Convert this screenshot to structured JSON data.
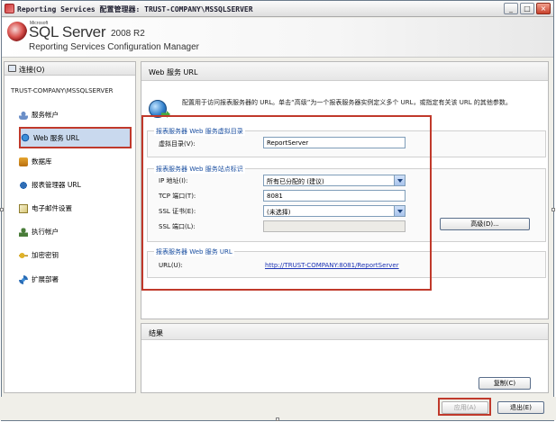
{
  "window": {
    "title": "Reporting Services 配置管理器: TRUST-COMPANY\\MSSQLSERVER",
    "controls": [
      "_",
      "□",
      "×"
    ]
  },
  "banner": {
    "microsoft": "Microsoft",
    "product": "SQL Server",
    "version": "2008 R2",
    "subtitle": "Reporting Services Configuration Manager"
  },
  "sidebar": {
    "connect_label": "连接(O)",
    "server_name": "TRUST-COMPANY\\MSSQLSERVER",
    "items": [
      {
        "label": "服务帐户",
        "icon": "service-account-icon"
      },
      {
        "label": "Web 服务 URL",
        "icon": "web-globe-icon",
        "active": true
      },
      {
        "label": "数据库",
        "icon": "database-icon"
      },
      {
        "label": "报表管理器 URL",
        "icon": "report-manager-icon"
      },
      {
        "label": "电子邮件设置",
        "icon": "email-icon"
      },
      {
        "label": "执行帐户",
        "icon": "execution-account-icon"
      },
      {
        "label": "加密密钥",
        "icon": "key-icon"
      },
      {
        "label": "扩展部署",
        "icon": "scale-out-icon"
      }
    ]
  },
  "main": {
    "section_title": "Web 服务 URL",
    "description": "配置用于访问报表服务器的 URL。单击“高级”为一个报表服务器实例定义多个 URL，或指定有关该 URL 的其他参数。",
    "virtual_dir_group": {
      "title": "报表服务器 Web 服务虚拟目录",
      "label": "虚拟目录(V):",
      "value": "ReportServer"
    },
    "site_group": {
      "title": "报表服务器 Web 服务站点标识",
      "ip_label": "IP 地址(I):",
      "ip_value": "所有已分配的 (建议)",
      "tcp_label": "TCP 端口(T):",
      "tcp_value": "8081",
      "ssl_cert_label": "SSL 证书(E):",
      "ssl_cert_value": "(未选择)",
      "ssl_port_label": "SSL 端口(L):",
      "ssl_port_value": "",
      "advanced_button": "高级(D)..."
    },
    "url_group": {
      "title": "报表服务器 Web 服务 URL",
      "label": "URL(U):",
      "link": "http://TRUST-COMPANY:8081/ReportServer"
    }
  },
  "results": {
    "title": "结果",
    "copy_button": "复制(C)"
  },
  "footer": {
    "apply_button": "应用(A)",
    "exit_button": "退出(E)"
  },
  "colors": {
    "highlight_border": "#c0392b",
    "link": "#1d34b5",
    "group_title": "#1b4fa0",
    "active_item_bg": "#c9d9ee"
  }
}
